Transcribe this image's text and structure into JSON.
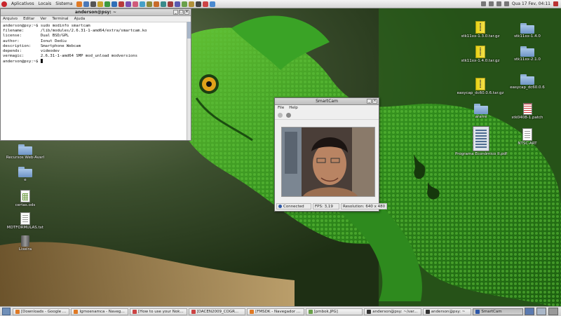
{
  "top_panel": {
    "menus": [
      "Aplicativos",
      "Locais",
      "Sistema"
    ],
    "clock": "Qua 17 Fev, 04:11"
  },
  "terminal": {
    "title": "anderson@psy: ~",
    "menus": [
      "Arquivo",
      "Editar",
      "Ver",
      "Terminal",
      "Ajuda"
    ],
    "lines": [
      "anderson@psy:~$ sudo modinfo smartcam",
      "filename:       /lib/modules/2.6.31-1-amd64/extra/smartcam.ko",
      "license:        Dual BSD/GPL",
      "author:         Ionut Dediu",
      "description:    Smartphone Webcam",
      "depends:        videodev",
      "vermagic:       2.6.31-1-amd64 SMP mod_unload modversions",
      "anderson@psy:~$ "
    ]
  },
  "smartcam": {
    "title": "SmartCam",
    "menus": [
      "File",
      "Help"
    ],
    "status": {
      "connection": "Connected",
      "fps": "FPS: 3,19",
      "resolution": "Resolution: 640 x 480"
    }
  },
  "desktop_icons": [
    {
      "label": "stk11xx-1.3.0.tar.gz",
      "type": "archive"
    },
    {
      "label": "stk11xx-1.4.0",
      "type": "folder"
    },
    {
      "label": "stk11xx-1.4.0.tar.gz",
      "type": "archive"
    },
    {
      "label": "stk11xx-2.1.0",
      "type": "folder"
    },
    {
      "label": "easycap_dc60.0.6.tar.gz",
      "type": "archive"
    },
    {
      "label": "easycap_dc60.0.6",
      "type": "folder"
    },
    {
      "label": "ararre",
      "type": "folder"
    },
    {
      "label": "stk0408-1.patch",
      "type": "patch"
    },
    {
      "label": "Programa Econômico II.pdf",
      "type": "pdf"
    },
    {
      "label": "NTSC-ART",
      "type": "doc"
    },
    {
      "label": "Recursos Web-Avarl",
      "type": "folder"
    },
    {
      "label": "e",
      "type": "folder"
    },
    {
      "label": "certas.ods",
      "type": "sheet"
    },
    {
      "label": "MDTFORMULAS.txt",
      "type": "doc"
    },
    {
      "label": "Lixeira",
      "type": "trash"
    }
  ],
  "taskbar": [
    {
      "label": "[Downloads - Google ...",
      "active": false
    },
    {
      "label": "Igmoenamca - Navega...",
      "active": false
    },
    {
      "label": "[How to use your Nok...",
      "active": false
    },
    {
      "label": "[DACEN2009_COGR...",
      "active": false
    },
    {
      "label": "[FMSDK - Navegador ...",
      "active": false
    },
    {
      "label": "[pmbok.JPG]",
      "active": false
    },
    {
      "label": "anderson@psy: ~/var...",
      "active": false
    },
    {
      "label": "anderson@psy: ~",
      "active": false
    },
    {
      "label": "SmartCam",
      "active": true
    }
  ]
}
